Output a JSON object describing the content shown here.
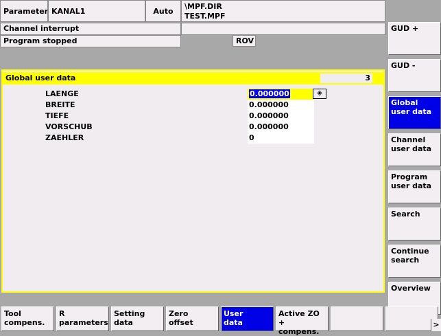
{
  "header": {
    "area": "Parameter",
    "channel": "KANAL1",
    "mode": "Auto",
    "program_path": "\\MPF.DIR",
    "program_name": "TEST.MPF",
    "channel_status": "Channel interrupt",
    "program_status": "Program stopped",
    "rov": "ROV"
  },
  "panel": {
    "title": "Global user data",
    "count": "3",
    "variables": [
      {
        "name": "LAENGE",
        "value": "0.000000"
      },
      {
        "name": "BREITE",
        "value": "0.000000"
      },
      {
        "name": "TIEFE",
        "value": "0.000000"
      },
      {
        "name": "VORSCHUB",
        "value": "0.000000"
      },
      {
        "name": "ZAEHLER",
        "value": "0"
      }
    ],
    "selected_index": 0
  },
  "vertical_softkeys": [
    {
      "label": "GUD +",
      "active": false
    },
    {
      "label": "GUD -",
      "active": false
    },
    {
      "label": "Global\nuser data",
      "active": true
    },
    {
      "label": "Channel\nuser data",
      "active": false
    },
    {
      "label": "Program\nuser data",
      "active": false
    },
    {
      "label": "Search",
      "active": false
    },
    {
      "label": "Continue\nsearch",
      "active": false
    },
    {
      "label": "Overview",
      "active": false
    }
  ],
  "horizontal_softkeys": [
    {
      "label": "Tool\ncompens.",
      "active": false
    },
    {
      "label": "R\nparameters",
      "active": false
    },
    {
      "label": "Setting\ndata",
      "active": false
    },
    {
      "label": "Zero\noffset",
      "active": false
    },
    {
      "label": "User\ndata",
      "active": true
    },
    {
      "label": "Active ZO\n+ compens.",
      "active": false
    },
    {
      "label": "",
      "active": false
    },
    {
      "label": "",
      "active": false
    }
  ],
  "etc_key": ">",
  "colors": {
    "accent": "#0000e6",
    "title_bar": "#ffff00",
    "background": "#a8a8a8"
  }
}
